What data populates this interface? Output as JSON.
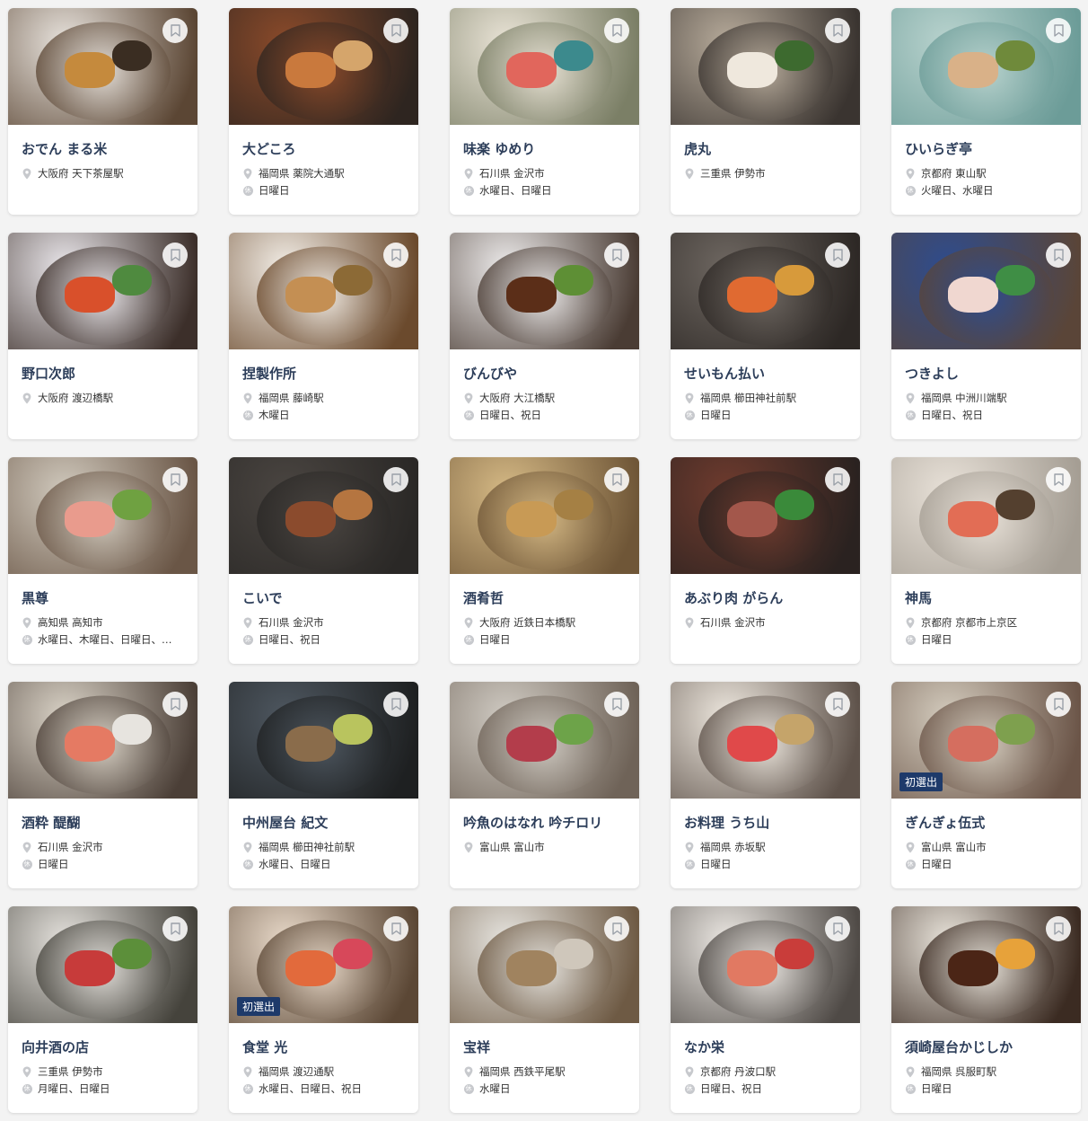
{
  "colors": {
    "name_text": "#2d3e5a",
    "badge_bg": "#1e3a6a",
    "icon_gray": "#c7c9cd"
  },
  "icons": {
    "bookmark": "bookmark-icon",
    "location": "location-pin-icon",
    "closed": "closed-day-icon"
  },
  "closed_glyph": "休",
  "restaurants": [
    {
      "name": "おでん まる米",
      "location": "大阪府 天下茶屋駅",
      "closed": "",
      "badge": "",
      "palette": [
        "#5b4634",
        "#e7e2dc",
        "#c58a3d",
        "#3a2d22"
      ]
    },
    {
      "name": "大どころ",
      "location": "福岡県 薬院大通駅",
      "closed": "日曜日",
      "badge": "",
      "palette": [
        "#2e2520",
        "#8a4a2a",
        "#c9793d",
        "#d5a56b"
      ]
    },
    {
      "name": "味楽 ゆめり",
      "location": "石川県 金沢市",
      "closed": "水曜日、日曜日",
      "badge": "",
      "palette": [
        "#7b7f66",
        "#e9e3d6",
        "#e1665c",
        "#3c8a8d"
      ]
    },
    {
      "name": "虎丸",
      "location": "三重県 伊勢市",
      "closed": "",
      "badge": "",
      "palette": [
        "#3a3430",
        "#b6aa9a",
        "#efe8dd",
        "#3d6a2f"
      ]
    },
    {
      "name": "ひいらぎ亭",
      "location": "京都府 東山駅",
      "closed": "火曜日、水曜日",
      "badge": "",
      "palette": [
        "#6c9c98",
        "#b9d3ce",
        "#d9b188",
        "#6f8a3b"
      ]
    },
    {
      "name": "野口次郎",
      "location": "大阪府 渡辺橋駅",
      "closed": "",
      "badge": "",
      "palette": [
        "#3c2f2a",
        "#e9e6ea",
        "#d9502b",
        "#4f8a3f"
      ]
    },
    {
      "name": "捏製作所",
      "location": "福岡県 藤崎駅",
      "closed": "木曜日",
      "badge": "",
      "palette": [
        "#6b4a2d",
        "#f2ede6",
        "#c48f53",
        "#8c6a36"
      ]
    },
    {
      "name": "びんびや",
      "location": "大阪府 大江橋駅",
      "closed": "日曜日、祝日",
      "badge": "",
      "palette": [
        "#4a3c34",
        "#eceaea",
        "#5b2e18",
        "#5e8f35"
      ]
    },
    {
      "name": "せいもん払い",
      "location": "福岡県 櫛田神社前駅",
      "closed": "日曜日",
      "badge": "",
      "palette": [
        "#2d2825",
        "#6e6761",
        "#e06a31",
        "#d79a3b"
      ]
    },
    {
      "name": "つきよし",
      "location": "福岡県 中洲川端駅",
      "closed": "日曜日、祝日",
      "badge": "",
      "palette": [
        "#5a4538",
        "#2e4c8e",
        "#f0d7d0",
        "#3f8e45"
      ]
    },
    {
      "name": "黒尊",
      "location": "高知県 高知市",
      "closed": "水曜日、木曜日、日曜日、…",
      "badge": "",
      "palette": [
        "#6a5646",
        "#d0c9bd",
        "#e99b8d",
        "#6fa141"
      ]
    },
    {
      "name": "こいで",
      "location": "石川県 金沢市",
      "closed": "日曜日、祝日",
      "badge": "",
      "palette": [
        "#2a2826",
        "#4a4541",
        "#8b4b2d",
        "#b57540"
      ]
    },
    {
      "name": "酒肴哲",
      "location": "大阪府 近鉄日本橋駅",
      "closed": "日曜日",
      "badge": "",
      "palette": [
        "#6f5637",
        "#d5b985",
        "#c89a55",
        "#a58044"
      ]
    },
    {
      "name": "あぶり肉 がらん",
      "location": "石川県 金沢市",
      "closed": "",
      "badge": "",
      "palette": [
        "#2a2220",
        "#6f3b2e",
        "#a3574b",
        "#3a8a3a"
      ]
    },
    {
      "name": "神馬",
      "location": "京都府 京都市上京区",
      "closed": "日曜日",
      "badge": "",
      "palette": [
        "#a59e94",
        "#e8e1d8",
        "#e26d55",
        "#54402f"
      ]
    },
    {
      "name": "酒粋 醍醐",
      "location": "石川県 金沢市",
      "closed": "日曜日",
      "badge": "",
      "palette": [
        "#4b3f37",
        "#d9d2c6",
        "#e57a63",
        "#e7e4df"
      ]
    },
    {
      "name": "中州屋台 紀文",
      "location": "福岡県 櫛田神社前駅",
      "closed": "水曜日、日曜日",
      "badge": "",
      "palette": [
        "#1e2021",
        "#4e5760",
        "#8a6c4b",
        "#b9c45e"
      ]
    },
    {
      "name": "吟魚のはなれ 吟チロリ",
      "location": "富山県 富山市",
      "closed": "",
      "badge": "",
      "palette": [
        "#6f6358",
        "#cfcac2",
        "#b33d4b",
        "#6da349"
      ]
    },
    {
      "name": "お料理 うち山",
      "location": "福岡県 赤坂駅",
      "closed": "日曜日",
      "badge": "",
      "palette": [
        "#5e524a",
        "#ece6dd",
        "#e0494a",
        "#c5a46a"
      ]
    },
    {
      "name": "ぎんぎょ伍式",
      "location": "富山県 富山市",
      "closed": "日曜日",
      "badge": "初選出",
      "palette": [
        "#6b5548",
        "#d3cbbd",
        "#d56e5f",
        "#7ea04e"
      ]
    },
    {
      "name": "向井酒の店",
      "location": "三重県 伊勢市",
      "closed": "月曜日、日曜日",
      "badge": "",
      "palette": [
        "#45433c",
        "#e4e1dc",
        "#c73b3a",
        "#5c8f3a"
      ]
    },
    {
      "name": "食堂 光",
      "location": "福岡県 渡辺通駅",
      "closed": "水曜日、日曜日、祝日",
      "badge": "初選出",
      "palette": [
        "#5b4735",
        "#e7d8c8",
        "#e26a3c",
        "#d7485a"
      ]
    },
    {
      "name": "宝祥",
      "location": "福岡県 西鉄平尾駅",
      "closed": "水曜日",
      "badge": "",
      "palette": [
        "#6e5a44",
        "#e6e4df",
        "#a0835f",
        "#cfc7bb"
      ]
    },
    {
      "name": "なか栄",
      "location": "京都府 丹波口駅",
      "closed": "日曜日、祝日",
      "badge": "",
      "palette": [
        "#4f4a46",
        "#ebe7e2",
        "#e17962",
        "#c93d3a"
      ]
    },
    {
      "name": "須崎屋台かじしか",
      "location": "福岡県 呉服町駅",
      "closed": "日曜日",
      "badge": "",
      "palette": [
        "#3b2b22",
        "#e8e3da",
        "#4b2516",
        "#e7a23a"
      ]
    }
  ]
}
